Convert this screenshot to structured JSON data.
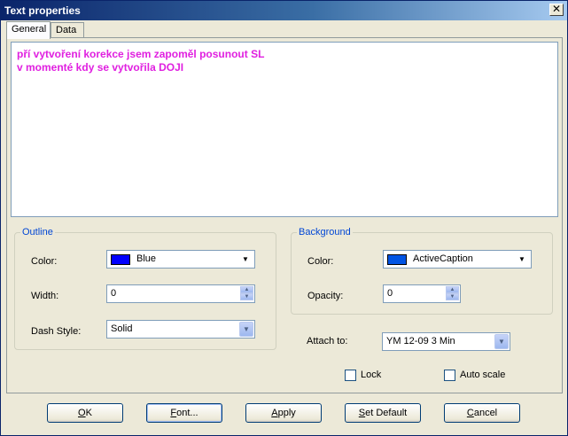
{
  "window": {
    "title": "Text properties",
    "close_glyph": "✕"
  },
  "tabs": [
    {
      "label": "General"
    },
    {
      "label": "Data"
    }
  ],
  "text_content": {
    "line1": "pří vytvoření korekce jsem zapoměl posunout SL",
    "line2": "v momenté kdy se vytvořila DOJI",
    "color": "#e020e0"
  },
  "outline": {
    "title": "Outline",
    "color_label": "Color:",
    "color_value": "Blue",
    "color_hex": "#0000ff",
    "width_label": "Width:",
    "width_value": "0",
    "dash_label": "Dash Style:",
    "dash_value": "Solid"
  },
  "background": {
    "title": "Background",
    "color_label": "Color:",
    "color_value": "ActiveCaption",
    "color_hex": "#0054e3",
    "opacity_label": "Opacity:",
    "opacity_value": "0"
  },
  "attach": {
    "label": "Attach to:",
    "value": "YM 12-09 3 Min"
  },
  "checkboxes": {
    "lock": "Lock",
    "auto_scale": "Auto scale"
  },
  "buttons": {
    "ok": {
      "hot": "O",
      "rest": "K"
    },
    "font": {
      "hot": "F",
      "rest": "ont..."
    },
    "apply": {
      "hot": "A",
      "rest": "pply"
    },
    "set_default": {
      "hot": "S",
      "rest": "et Default"
    },
    "cancel": {
      "hot": "C",
      "rest": "ancel"
    }
  },
  "icons": {
    "dropdown": "chevron-down-icon",
    "spin_up": "spin-up-icon",
    "spin_down": "spin-down-icon",
    "close": "close-icon"
  }
}
